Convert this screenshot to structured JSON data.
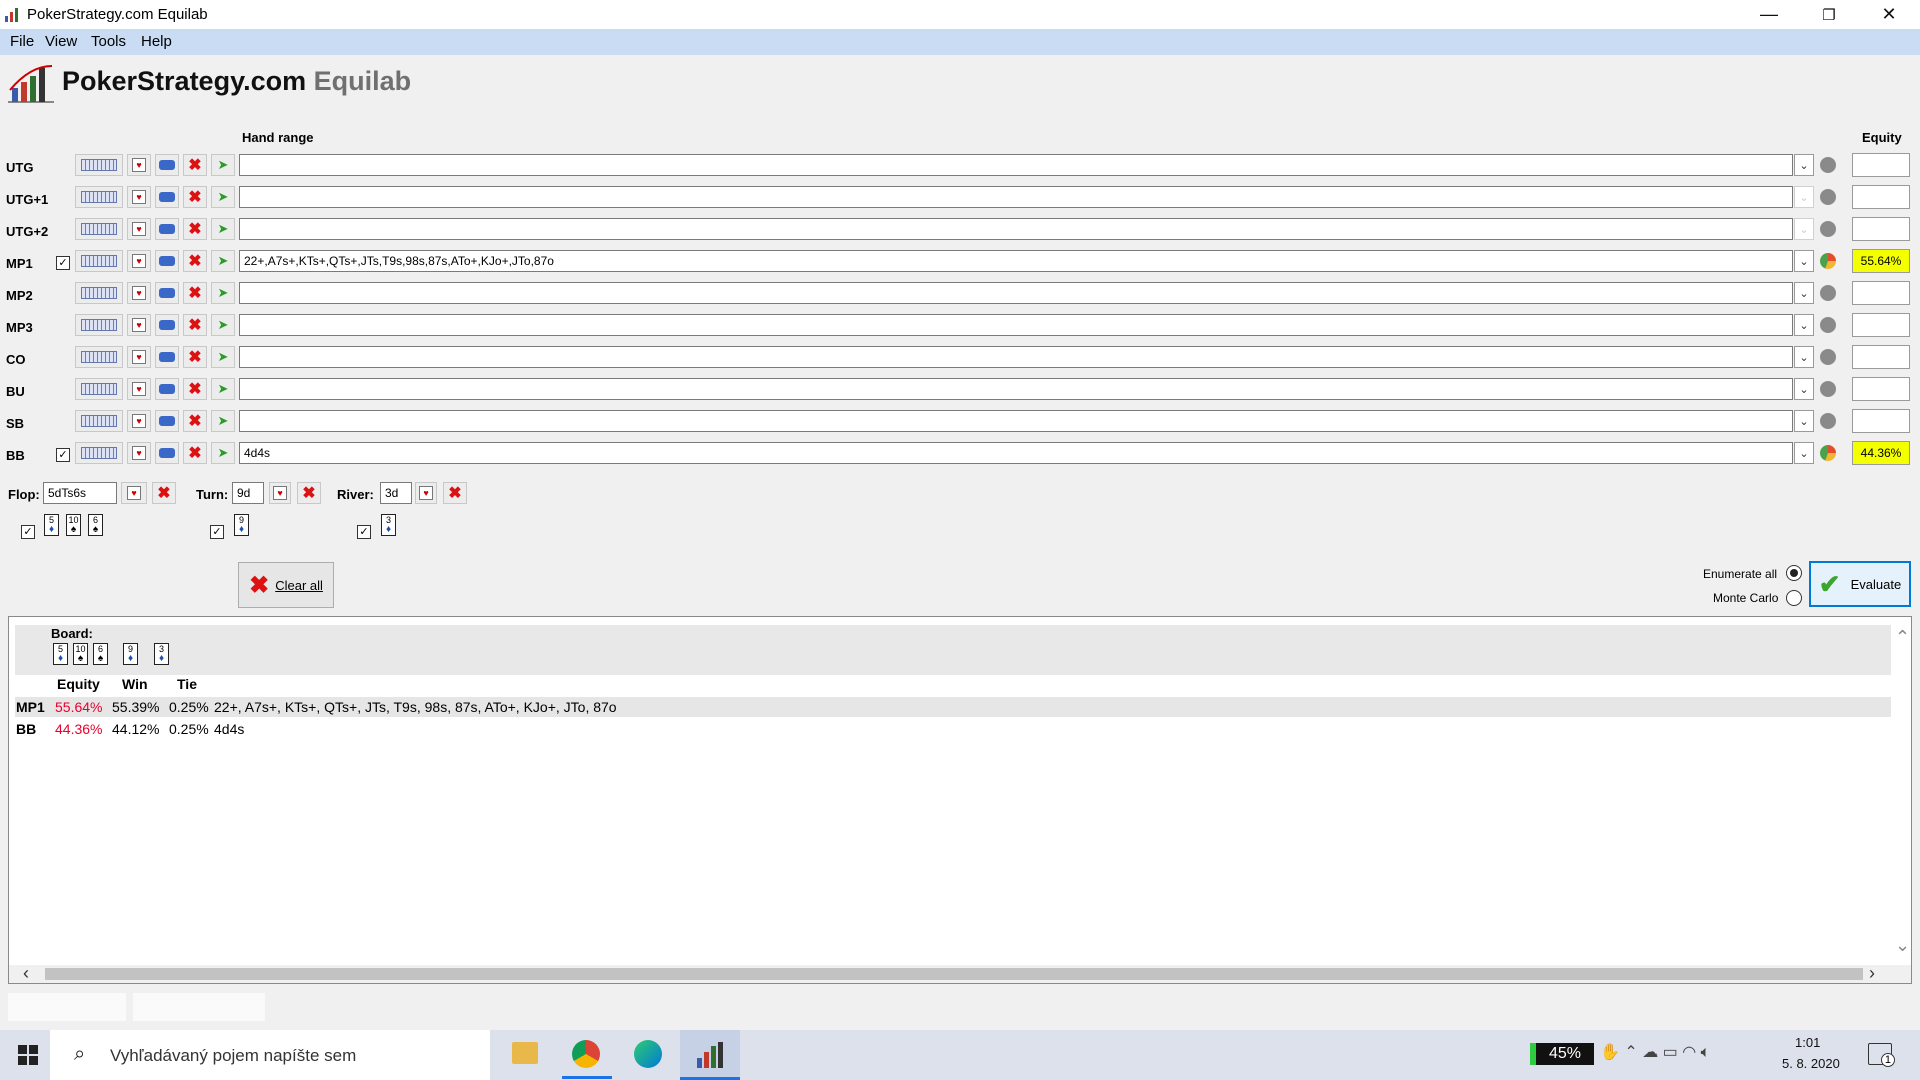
{
  "window": {
    "title": "PokerStrategy.com Equilab",
    "min": "—",
    "max": "❐",
    "close": "✕"
  },
  "menu": [
    "File",
    "View",
    "Tools",
    "Help"
  ],
  "logo": {
    "brand": "PokerStrategy.com",
    "product": "Equilab"
  },
  "headers": {
    "hand_range": "Hand range",
    "equity": "Equity"
  },
  "players": [
    {
      "label": "UTG",
      "checked": false,
      "range": "",
      "equity": "",
      "active": false
    },
    {
      "label": "UTG+1",
      "checked": false,
      "range": "",
      "equity": "",
      "active": false
    },
    {
      "label": "UTG+2",
      "checked": false,
      "range": "",
      "equity": "",
      "active": false
    },
    {
      "label": "MP1",
      "checked": true,
      "range": "22+,A7s+,KTs+,QTs+,JTs,T9s,98s,87s,ATo+,KJo+,JTo,87o",
      "equity": "55.64%",
      "active": true
    },
    {
      "label": "MP2",
      "checked": false,
      "range": "",
      "equity": "",
      "active": false
    },
    {
      "label": "MP3",
      "checked": false,
      "range": "",
      "equity": "",
      "active": false
    },
    {
      "label": "CO",
      "checked": false,
      "range": "",
      "equity": "",
      "active": false
    },
    {
      "label": "BU",
      "checked": false,
      "range": "",
      "equity": "",
      "active": false
    },
    {
      "label": "SB",
      "checked": false,
      "range": "",
      "equity": "",
      "active": false
    },
    {
      "label": "BB",
      "checked": true,
      "range": "4d4s",
      "equity": "44.36%",
      "active": true
    }
  ],
  "board": {
    "flop_label": "Flop:",
    "flop_value": "5dTs6s",
    "turn_label": "Turn:",
    "turn_value": "9d",
    "river_label": "River:",
    "river_value": "3d",
    "flop_cards": [
      {
        "rank": "5",
        "suit": "♦",
        "cls": "d"
      },
      {
        "rank": "10",
        "suit": "♠",
        "cls": "sp"
      },
      {
        "rank": "6",
        "suit": "♠",
        "cls": "sp"
      }
    ],
    "turn_cards": [
      {
        "rank": "9",
        "suit": "♦",
        "cls": "d"
      }
    ],
    "river_cards": [
      {
        "rank": "3",
        "suit": "♦",
        "cls": "d"
      }
    ]
  },
  "buttons": {
    "clear_all": "Clear all",
    "evaluate": "Evaluate"
  },
  "mode": {
    "enumerate_all": "Enumerate all",
    "monte_carlo": "Monte Carlo",
    "selected": "enumerate_all"
  },
  "results": {
    "board_label": "Board:",
    "columns": [
      "Equity",
      "Win",
      "Tie"
    ],
    "rows": [
      {
        "player": "MP1",
        "equity": "55.64%",
        "win": "55.39%",
        "tie": "0.25%",
        "hands": "22+, A7s+, KTs+, QTs+, JTs, T9s, 98s, 87s, ATo+, KJo+, JTo, 87o"
      },
      {
        "player": "BB",
        "equity": "44.36%",
        "win": "44.12%",
        "tie": "0.25%",
        "hands": "4d4s"
      }
    ]
  },
  "taskbar": {
    "search_placeholder": "Vyhľadávaný pojem napíšte sem",
    "battery": "45%",
    "time": "1:01",
    "date": "5. 8. 2020",
    "notification_count": "1"
  }
}
